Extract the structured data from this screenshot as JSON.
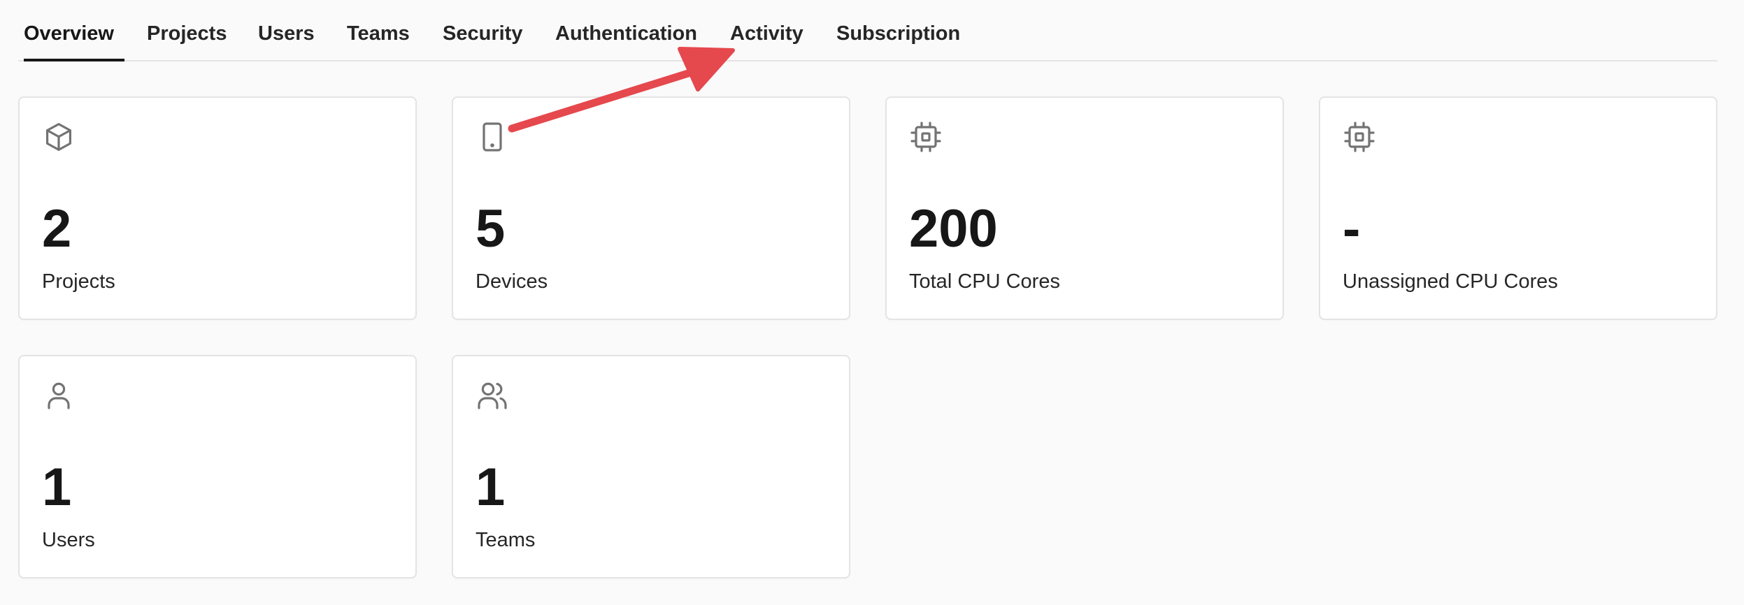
{
  "tabs": [
    {
      "label": "Overview",
      "active": true
    },
    {
      "label": "Projects",
      "active": false
    },
    {
      "label": "Users",
      "active": false
    },
    {
      "label": "Teams",
      "active": false
    },
    {
      "label": "Security",
      "active": false
    },
    {
      "label": "Authentication",
      "active": false
    },
    {
      "label": "Activity",
      "active": false
    },
    {
      "label": "Subscription",
      "active": false
    }
  ],
  "cards": [
    {
      "icon": "cube-icon",
      "value": "2",
      "label": "Projects"
    },
    {
      "icon": "tablet-icon",
      "value": "5",
      "label": "Devices"
    },
    {
      "icon": "cpu-icon",
      "value": "200",
      "label": "Total CPU Cores"
    },
    {
      "icon": "cpu-icon",
      "value": "-",
      "label": "Unassigned CPU Cores"
    },
    {
      "icon": "user-icon",
      "value": "1",
      "label": "Users"
    },
    {
      "icon": "users-icon",
      "value": "1",
      "label": "Teams"
    }
  ],
  "colors": {
    "background": "#fafafa",
    "card": "#ffffff",
    "border": "#e4e4e4",
    "text": "#171717",
    "icon": "#737373",
    "annotation_arrow": "#e5484d"
  }
}
